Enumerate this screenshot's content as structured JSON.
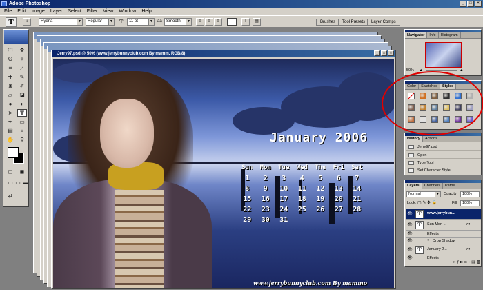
{
  "app": {
    "title": "Adobe Photoshop"
  },
  "window_buttons": [
    "_",
    "□",
    "×"
  ],
  "menu": [
    "File",
    "Edit",
    "Image",
    "Layer",
    "Select",
    "Filter",
    "View",
    "Window",
    "Help"
  ],
  "options": {
    "tool_glyph": "T",
    "font_family": "Hyena",
    "font_style": "Regular",
    "size_prefix": "T",
    "font_size": "11 pt",
    "aa_prefix": "aa",
    "antialias": "Smooth",
    "well_tabs": [
      "Brushes",
      "Tool Presets",
      "Layer Comps"
    ]
  },
  "document": {
    "title": "Jerry97.psd @ 50% (www.jerrybunnyclub.com By mamm, RGB/8)",
    "calendar_title": "January  2006",
    "weekdays": [
      "Sun",
      "Mon",
      "Tue",
      "Wed",
      "Thu",
      "Fri",
      "Sat"
    ],
    "weeks": [
      [
        "1",
        "2",
        "3",
        "4",
        "5",
        "6",
        "7"
      ],
      [
        "8",
        "9",
        "10",
        "11",
        "12",
        "13",
        "14"
      ],
      [
        "15",
        "16",
        "17",
        "18",
        "19",
        "20",
        "21"
      ],
      [
        "22",
        "23",
        "24",
        "25",
        "26",
        "27",
        "28"
      ],
      [
        "29",
        "30",
        "31",
        "",
        "",
        "",
        ""
      ]
    ],
    "website": "www.jerrybunnyclub.com By mammo"
  },
  "navigator": {
    "tabs": [
      "Navigator",
      "Info",
      "Histogram"
    ],
    "zoom": "50%"
  },
  "styles_panel": {
    "tabs": [
      "Color",
      "Swatches",
      "Styles"
    ],
    "swatch_colors": [
      "#ffffff",
      "#d07020",
      "#806040",
      "#303030",
      "#3070d0",
      "#b0b0b0",
      "#806050",
      "#c08030",
      "#6080a0",
      "#e0c060",
      "#404060",
      "#a0a0c0",
      "#c07040",
      "#e0e0e0",
      "#4060a0",
      "#5080c0",
      "#7030a0",
      "#6a5acd"
    ],
    "highlight": "#e00000"
  },
  "history_panel": {
    "tabs": [
      "History",
      "Actions"
    ],
    "snapshot": "Jerry97.psd",
    "items": [
      "Open",
      "Type Tool",
      "Set Character Style"
    ]
  },
  "layers_panel": {
    "tabs": [
      "Layers",
      "Channels",
      "Paths"
    ],
    "blend_mode": "Normal",
    "opacity_label": "Opacity:",
    "opacity": "100%",
    "lock_label": "Lock:",
    "fill_label": "Fill:",
    "fill": "100%",
    "layers": [
      {
        "name": "www.jerrybun...",
        "selected": true
      },
      {
        "name": "Sun  Mon ...",
        "selected": false,
        "effects": [
          "Effects",
          "Drop Shadow"
        ]
      },
      {
        "name": "January  2...",
        "selected": false,
        "effects": [
          "Effects"
        ]
      }
    ]
  }
}
